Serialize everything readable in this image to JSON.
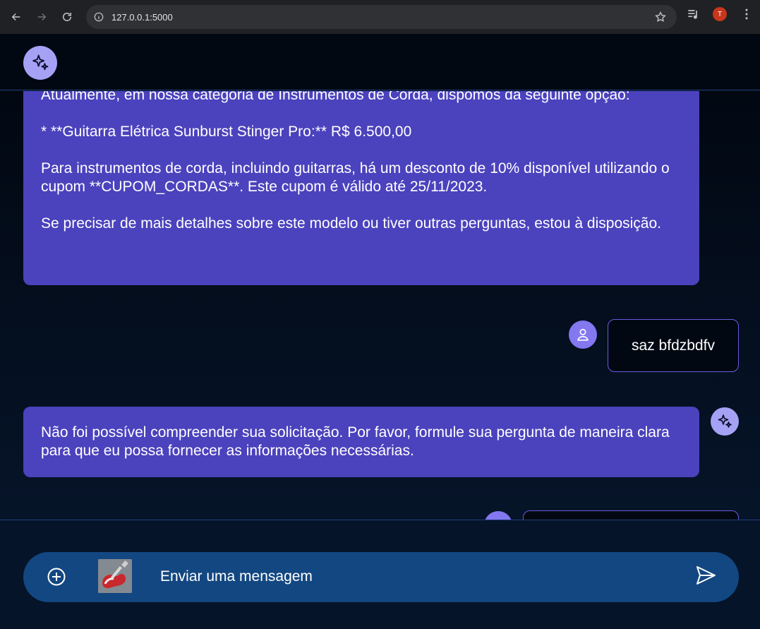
{
  "browser": {
    "url": "127.0.0.1:5000",
    "profile_initial": "T"
  },
  "messages": [
    {
      "role": "bot",
      "text": "Atualmente, em nossa categoria de Instrumentos de Corda, dispomos da seguinte opção:\n\n* **Guitarra Elétrica Sunburst Stinger Pro:** R$ 6.500,00\n\nPara instrumentos de corda, incluindo guitarras, há um desconto de 10% disponível utilizando o cupom **CUPOM_CORDAS**. Este cupom é válido até 25/11/2023.\n\nSe precisar de mais detalhes sobre este modelo ou tiver outras perguntas, estou à disposição."
    },
    {
      "role": "user",
      "text": "saz bfdzbdfv"
    },
    {
      "role": "bot",
      "text": "Não foi possível compreender sua solicitação. Por favor, formule sua pergunta de maneira clara para que eu possa fornecer as informações necessárias."
    },
    {
      "role": "user",
      "text": ""
    }
  ],
  "composer": {
    "placeholder": "Enviar uma mensagem",
    "attachment_icon": "guitar-thumbnail"
  },
  "colors": {
    "bot_bubble": "#4b42bd",
    "user_bubble_border": "#6a5ae0",
    "bot_avatar": "#a5a2f5",
    "user_avatar": "#8378f0",
    "input_bar": "#134781"
  }
}
